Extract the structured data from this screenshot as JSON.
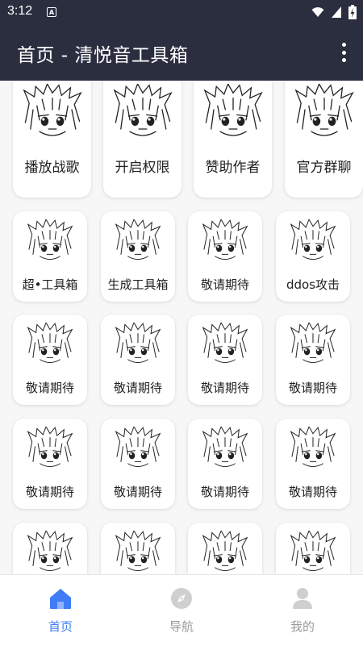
{
  "status_bar": {
    "time": "3:12",
    "notification_letter": "A"
  },
  "app_bar": {
    "title": "首页 - 清悦音工具箱"
  },
  "top_row": [
    {
      "label": "播放战歌"
    },
    {
      "label": "开启权限"
    },
    {
      "label": "赞助作者"
    },
    {
      "label": "官方群聊"
    }
  ],
  "grid": [
    {
      "label": "超•工具箱"
    },
    {
      "label": "生成工具箱"
    },
    {
      "label": "敬请期待"
    },
    {
      "label": "ddos攻击"
    },
    {
      "label": "敬请期待"
    },
    {
      "label": "敬请期待"
    },
    {
      "label": "敬请期待"
    },
    {
      "label": "敬请期待"
    },
    {
      "label": "敬请期待"
    },
    {
      "label": "敬请期待"
    },
    {
      "label": "敬请期待"
    },
    {
      "label": "敬请期待"
    },
    {
      "label": ""
    },
    {
      "label": ""
    },
    {
      "label": ""
    },
    {
      "label": ""
    }
  ],
  "bottom_nav": [
    {
      "label": "首页",
      "icon": "home-icon",
      "active": true
    },
    {
      "label": "导航",
      "icon": "compass-icon",
      "active": false
    },
    {
      "label": "我的",
      "icon": "person-icon",
      "active": false
    }
  ],
  "colors": {
    "bar": "#2b2e3f",
    "accent": "#3f7cf6",
    "inactive": "#999999"
  }
}
